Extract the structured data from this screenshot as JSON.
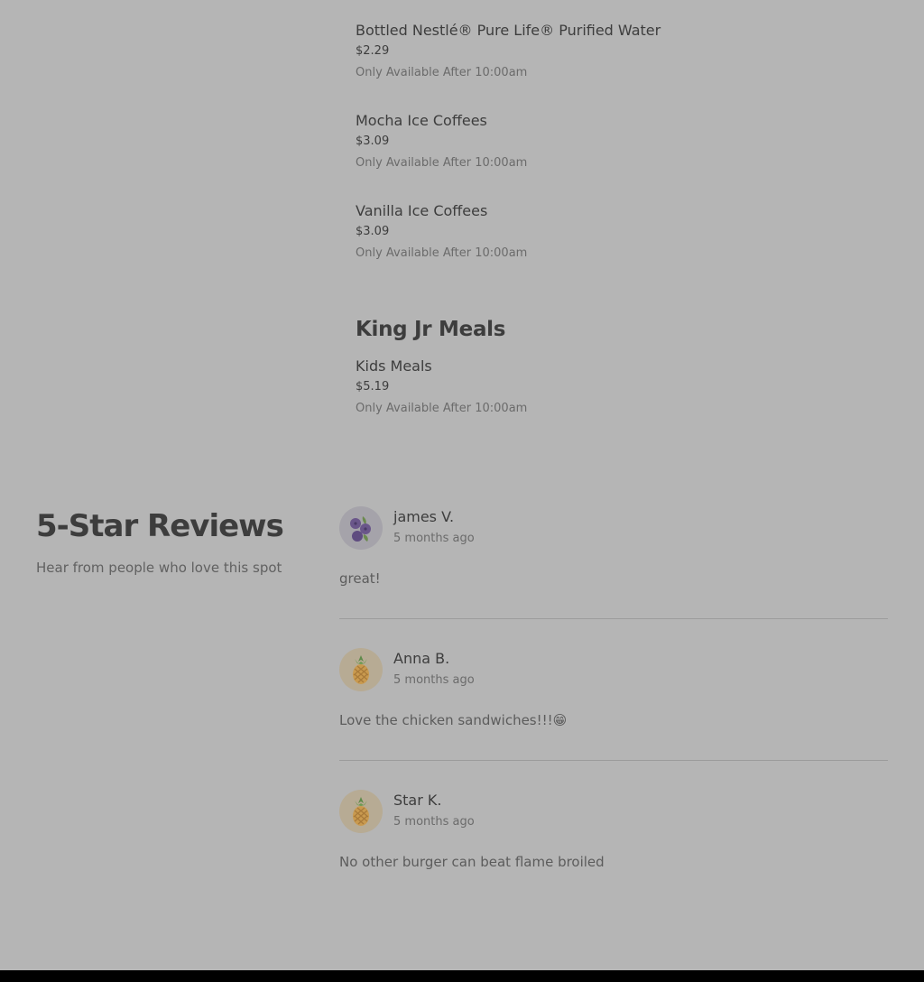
{
  "menu": {
    "items": [
      {
        "name": "Bottled Nestlé® Pure Life® Purified Water",
        "price": "$2.29",
        "availability": "Only Available After 10:00am"
      },
      {
        "name": "Mocha Ice Coffees",
        "price": "$3.09",
        "availability": "Only Available After 10:00am"
      },
      {
        "name": "Vanilla Ice Coffees",
        "price": "$3.09",
        "availability": "Only Available After 10:00am"
      }
    ],
    "section": {
      "title": "King Jr Meals",
      "items": [
        {
          "name": "Kids Meals",
          "price": "$5.19",
          "availability": "Only Available After 10:00am"
        }
      ]
    }
  },
  "reviews": {
    "heading": "5-Star Reviews",
    "subheading": "Hear from people who love this spot",
    "list": [
      {
        "name": "james V.",
        "time": "5 months ago",
        "text": "great!",
        "avatar_icon": "blueberry-icon"
      },
      {
        "name": "Anna B.",
        "time": "5 months ago",
        "text": "Love the chicken sandwiches!!!😁",
        "avatar_icon": "pineapple-icon"
      },
      {
        "name": "Star K.",
        "time": "5 months ago",
        "text": "No other burger can beat flame broiled",
        "avatar_icon": "pineapple-icon"
      }
    ]
  },
  "colors": {
    "overlay_background": "#b5b5b5",
    "text_primary": "#3d3d3d",
    "text_secondary": "#6b6b6b",
    "footer": "#000000"
  }
}
